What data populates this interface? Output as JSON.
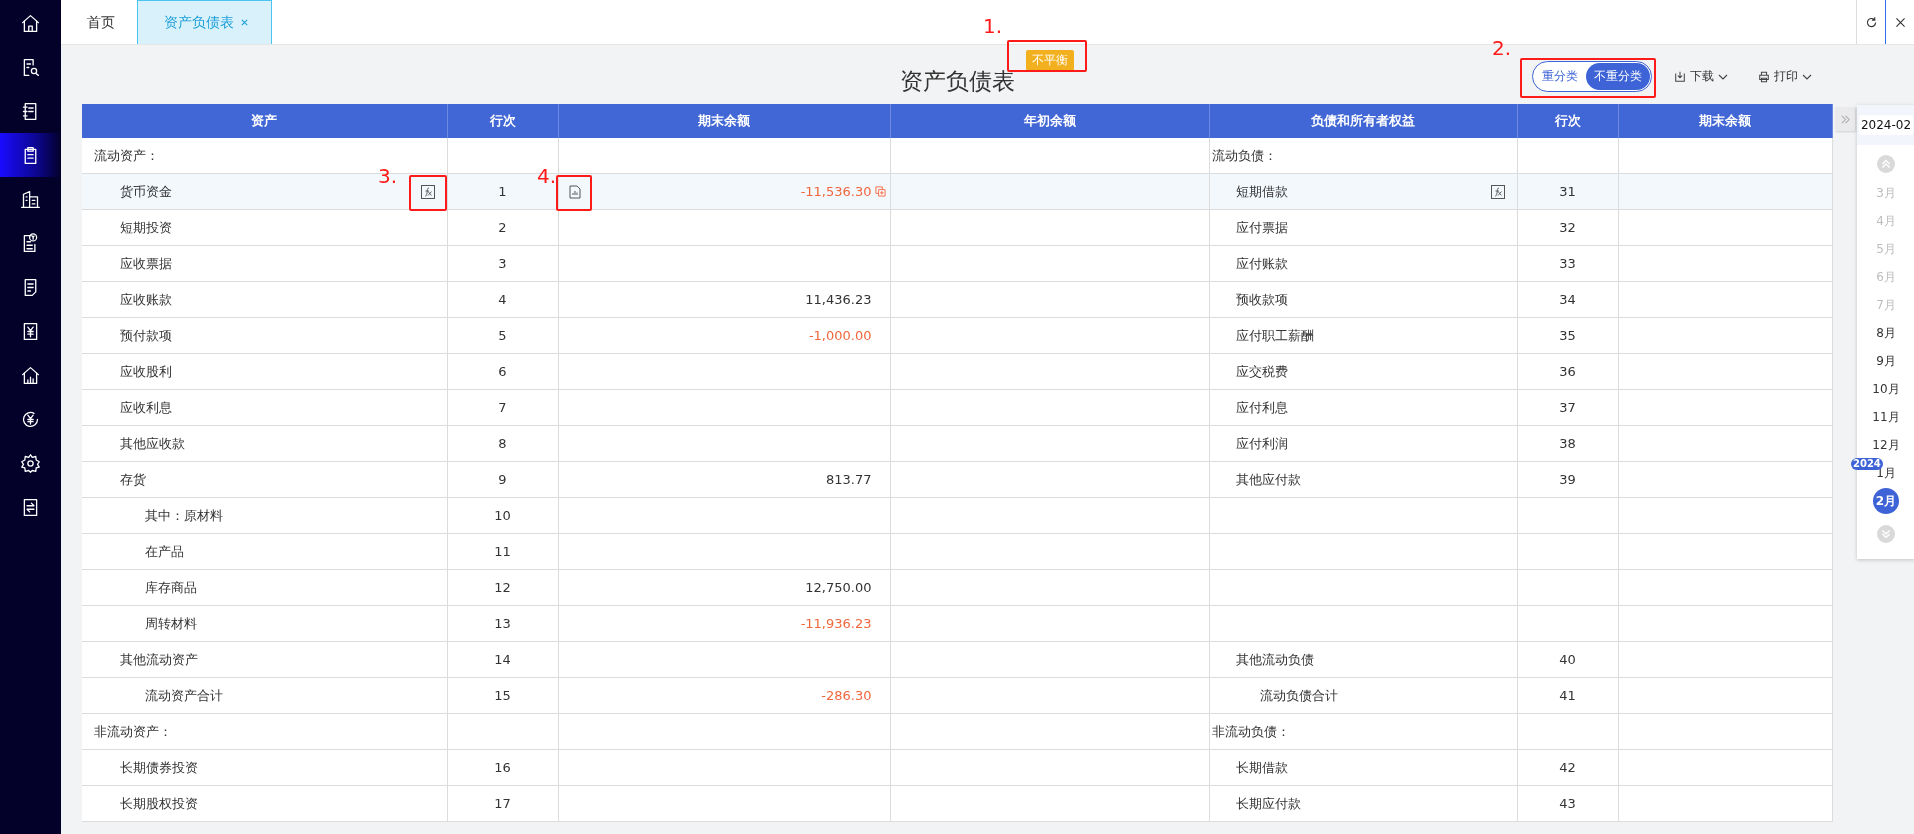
{
  "sidebar": {
    "items": [
      {
        "selected": false
      },
      {
        "selected": false
      },
      {
        "selected": false
      },
      {
        "selected": true
      },
      {
        "selected": false
      },
      {
        "selected": false
      },
      {
        "selected": false
      },
      {
        "selected": false
      },
      {
        "selected": false
      },
      {
        "selected": false
      },
      {
        "selected": false
      },
      {
        "selected": false
      }
    ]
  },
  "tabs": [
    {
      "label": "首页",
      "selected": false,
      "closable": false
    },
    {
      "label": "资产负债表",
      "selected": true,
      "closable": true
    }
  ],
  "report": {
    "title": "资产负债表",
    "status_badge": "不平衡",
    "classify_toggle": [
      {
        "label": "重分类",
        "selected": false
      },
      {
        "label": "不重分类",
        "selected": true
      }
    ],
    "actions": [
      {
        "label": "下载",
        "kind": "download"
      },
      {
        "label": "打印",
        "kind": "print"
      }
    ]
  },
  "annotations": [
    "1.",
    "2.",
    "3.",
    "4."
  ],
  "table": {
    "columns": [
      "资产",
      "行次",
      "期末余额",
      "年初余额",
      "负债和所有者权益",
      "行次",
      "期末余额"
    ],
    "rows": [
      {
        "highlighted": false,
        "assets": {
          "label": "流动资产：",
          "kind": "section"
        },
        "liabilities": {
          "label": "流动负债：",
          "kind": "section"
        }
      },
      {
        "highlighted": true,
        "assets": {
          "label": "货币资金",
          "kind": "item",
          "line": "1",
          "end_balance": "-11,536.30",
          "negative": true,
          "formula": true,
          "source_doc": true,
          "copy": true
        },
        "liabilities": {
          "label": "短期借款",
          "kind": "item",
          "line": "31",
          "formula": true
        }
      },
      {
        "highlighted": false,
        "assets": {
          "label": "短期投资",
          "kind": "item",
          "line": "2"
        },
        "liabilities": {
          "label": "应付票据",
          "kind": "item",
          "line": "32"
        }
      },
      {
        "highlighted": false,
        "assets": {
          "label": "应收票据",
          "kind": "item",
          "line": "3"
        },
        "liabilities": {
          "label": "应付账款",
          "kind": "item",
          "line": "33"
        }
      },
      {
        "highlighted": false,
        "assets": {
          "label": "应收账款",
          "kind": "item",
          "line": "4",
          "end_balance": "11,436.23",
          "negative": false
        },
        "liabilities": {
          "label": "预收款项",
          "kind": "item",
          "line": "34"
        }
      },
      {
        "highlighted": false,
        "assets": {
          "label": "预付款项",
          "kind": "item",
          "line": "5",
          "end_balance": "-1,000.00",
          "negative": true
        },
        "liabilities": {
          "label": "应付职工薪酬",
          "kind": "item",
          "line": "35"
        }
      },
      {
        "highlighted": false,
        "assets": {
          "label": "应收股利",
          "kind": "item",
          "line": "6"
        },
        "liabilities": {
          "label": "应交税费",
          "kind": "item",
          "line": "36"
        }
      },
      {
        "highlighted": false,
        "assets": {
          "label": "应收利息",
          "kind": "item",
          "line": "7"
        },
        "liabilities": {
          "label": "应付利息",
          "kind": "item",
          "line": "37"
        }
      },
      {
        "highlighted": false,
        "assets": {
          "label": "其他应收款",
          "kind": "item",
          "line": "8"
        },
        "liabilities": {
          "label": "应付利润",
          "kind": "item",
          "line": "38"
        }
      },
      {
        "highlighted": false,
        "assets": {
          "label": "存货",
          "kind": "item",
          "line": "9",
          "end_balance": "813.77",
          "negative": false
        },
        "liabilities": {
          "label": "其他应付款",
          "kind": "item",
          "line": "39"
        }
      },
      {
        "highlighted": false,
        "assets": {
          "label": "其中：原材料",
          "kind": "sub",
          "line": "10"
        }
      },
      {
        "highlighted": false,
        "assets": {
          "label": "在产品",
          "kind": "sub",
          "line": "11"
        }
      },
      {
        "highlighted": false,
        "assets": {
          "label": "库存商品",
          "kind": "sub",
          "line": "12",
          "end_balance": "12,750.00",
          "negative": false
        }
      },
      {
        "highlighted": false,
        "assets": {
          "label": "周转材料",
          "kind": "sub",
          "line": "13",
          "end_balance": "-11,936.23",
          "negative": true
        }
      },
      {
        "highlighted": false,
        "assets": {
          "label": "其他流动资产",
          "kind": "item",
          "line": "14"
        },
        "liabilities": {
          "label": "其他流动负债",
          "kind": "item",
          "line": "40"
        }
      },
      {
        "highlighted": false,
        "assets": {
          "label": "流动资产合计",
          "kind": "sub",
          "line": "15",
          "end_balance": "-286.30",
          "negative": true
        },
        "liabilities": {
          "label": "流动负债合计",
          "kind": "sub",
          "line": "41"
        }
      },
      {
        "highlighted": false,
        "assets": {
          "label": "非流动资产：",
          "kind": "section"
        },
        "liabilities": {
          "label": "非流动负债：",
          "kind": "section"
        }
      },
      {
        "highlighted": false,
        "assets": {
          "label": "长期债券投资",
          "kind": "item",
          "line": "16"
        },
        "liabilities": {
          "label": "长期借款",
          "kind": "item",
          "line": "42"
        }
      },
      {
        "highlighted": false,
        "assets": {
          "label": "长期股权投资",
          "kind": "item",
          "line": "17"
        },
        "liabilities": {
          "label": "长期应付款",
          "kind": "item",
          "line": "43"
        }
      }
    ]
  },
  "period_picker": {
    "value": "2024-02",
    "months": [
      {
        "label": "3月",
        "disabled": true,
        "selected": false
      },
      {
        "label": "4月",
        "disabled": true,
        "selected": false
      },
      {
        "label": "5月",
        "disabled": true,
        "selected": false
      },
      {
        "label": "6月",
        "disabled": true,
        "selected": false
      },
      {
        "label": "7月",
        "disabled": true,
        "selected": false
      },
      {
        "label": "8月",
        "disabled": false,
        "selected": false
      },
      {
        "label": "9月",
        "disabled": false,
        "selected": false
      },
      {
        "label": "10月",
        "disabled": false,
        "selected": false
      },
      {
        "label": "11月",
        "disabled": false,
        "selected": false
      },
      {
        "label": "12月",
        "disabled": false,
        "selected": false
      },
      {
        "label": "1月",
        "disabled": false,
        "selected": false,
        "year_badge": "2024"
      },
      {
        "label": "2月",
        "disabled": false,
        "selected": true
      }
    ]
  }
}
